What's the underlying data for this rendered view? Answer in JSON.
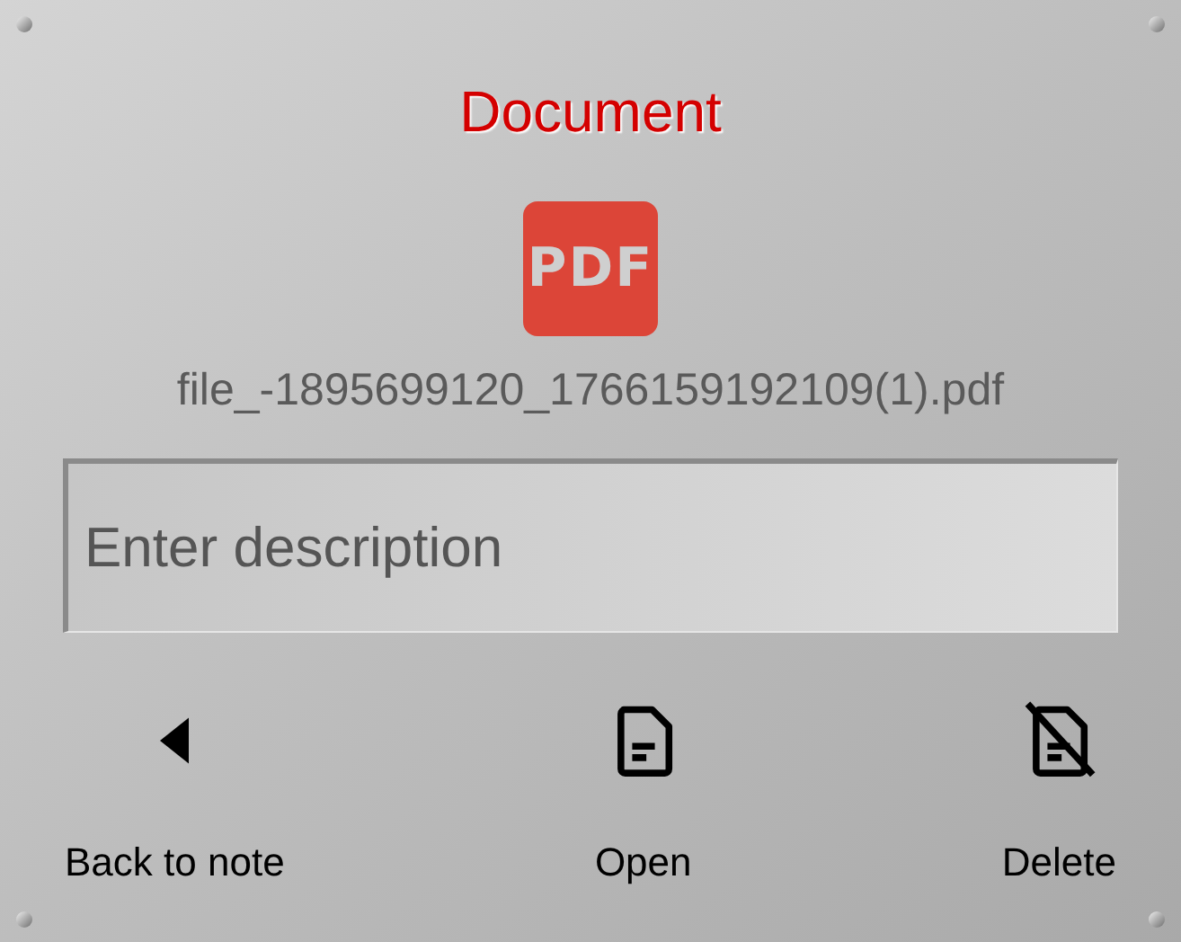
{
  "title": "Document",
  "file": {
    "type_label": "PDF",
    "name": "file_-1895699120_1766159192109(1).pdf"
  },
  "description": {
    "placeholder": "Enter description"
  },
  "actions": [
    {
      "kind": "back",
      "label": "Back to note"
    },
    {
      "kind": "open",
      "label": "Open"
    },
    {
      "kind": "delete",
      "label": "Delete"
    }
  ]
}
